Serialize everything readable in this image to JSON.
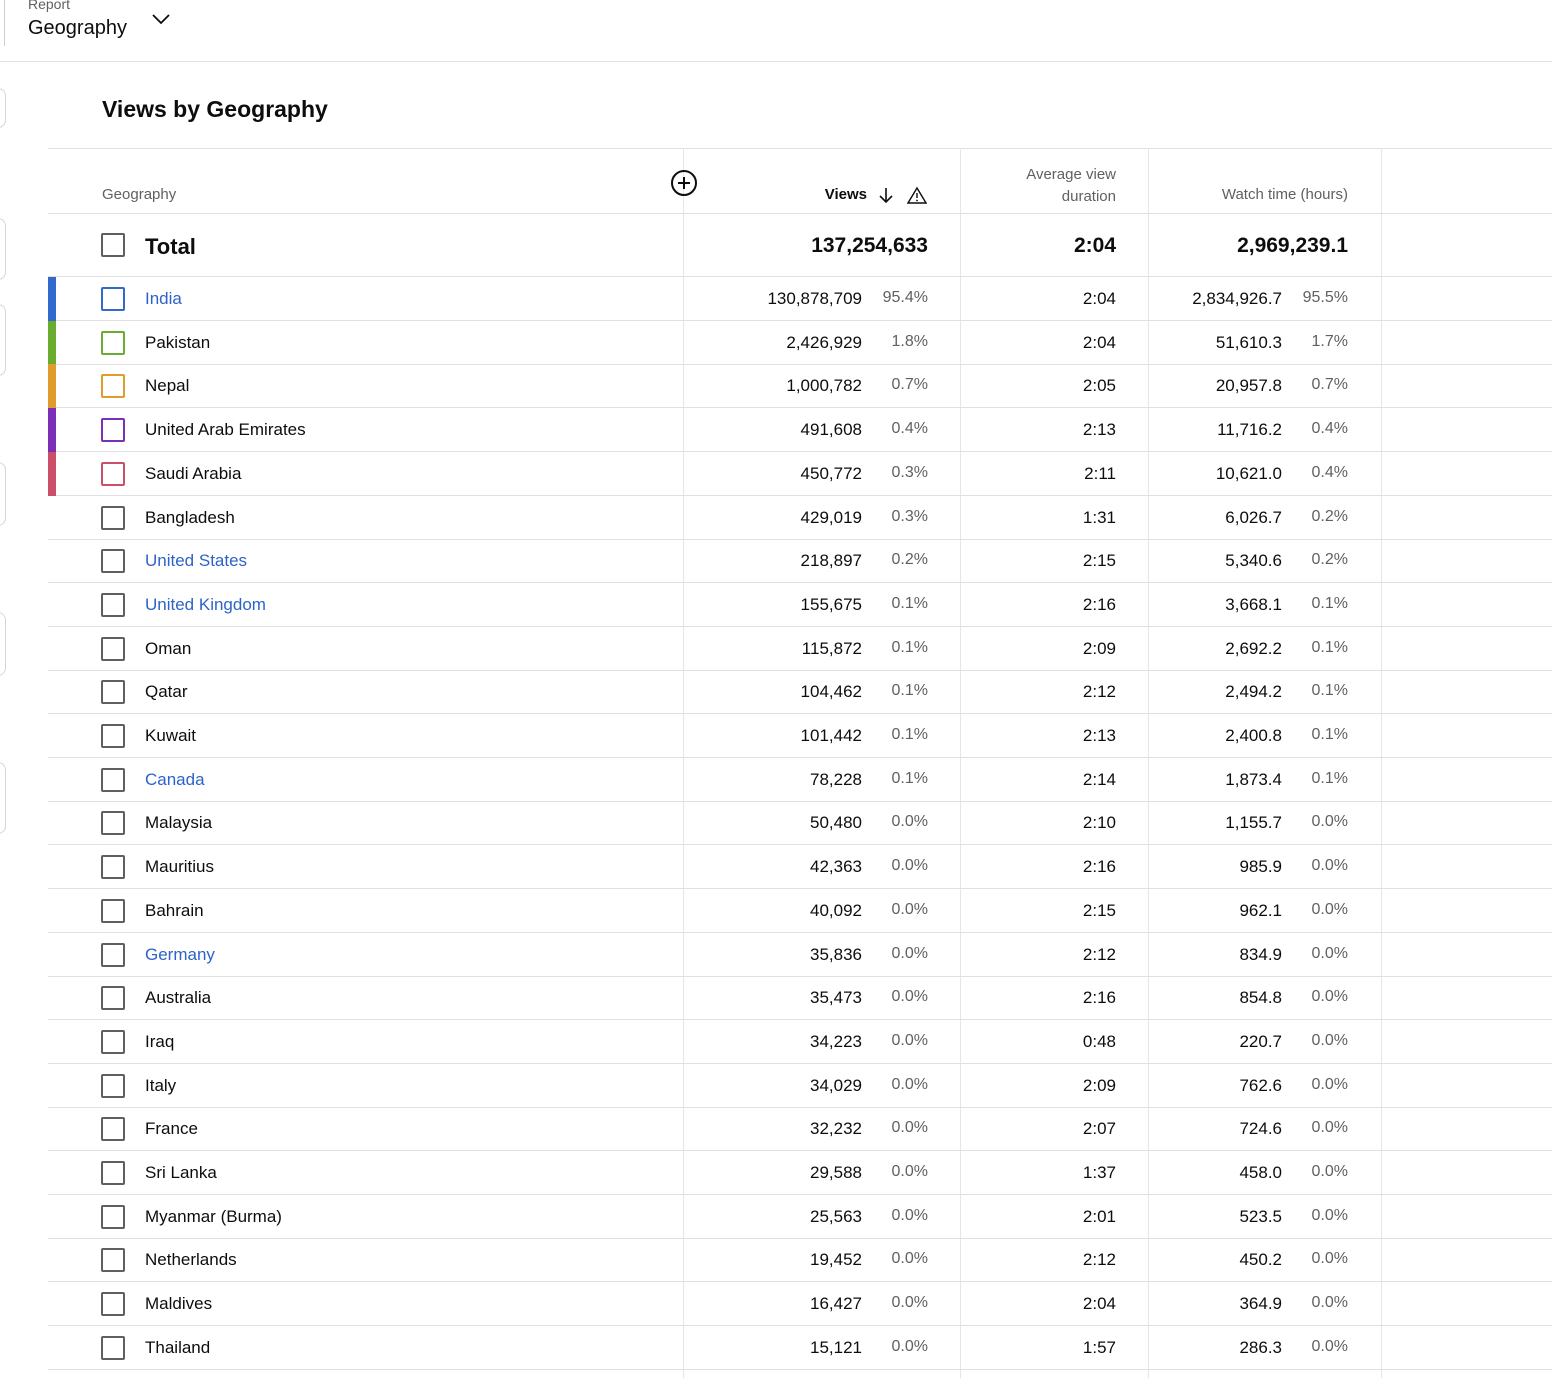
{
  "report": {
    "label": "Report",
    "value": "Geography"
  },
  "title": "Views by Geography",
  "table": {
    "headers": {
      "geography": "Geography",
      "views": "Views",
      "avg_view_duration_line1": "Average view",
      "avg_view_duration_line2": "duration",
      "watch_time": "Watch time (hours)"
    },
    "total": {
      "label": "Total",
      "views": "137,254,633",
      "avg_view_duration": "2:04",
      "watch_time": "2,969,239.1"
    },
    "rows": [
      {
        "name": "India",
        "views": "130,878,709",
        "views_pct": "95.4%",
        "avd": "2:04",
        "wt": "2,834,926.7",
        "wt_pct": "95.5%",
        "color": "#3169cc",
        "link": true
      },
      {
        "name": "Pakistan",
        "views": "2,426,929",
        "views_pct": "1.8%",
        "avd": "2:04",
        "wt": "51,610.3",
        "wt_pct": "1.7%",
        "color": "#6aac2f",
        "link": false
      },
      {
        "name": "Nepal",
        "views": "1,000,782",
        "views_pct": "0.7%",
        "avd": "2:05",
        "wt": "20,957.8",
        "wt_pct": "0.7%",
        "color": "#e09b2d",
        "link": false
      },
      {
        "name": "United Arab Emirates",
        "views": "491,608",
        "views_pct": "0.4%",
        "avd": "2:13",
        "wt": "11,716.2",
        "wt_pct": "0.4%",
        "color": "#7a2fb6",
        "link": false
      },
      {
        "name": "Saudi Arabia",
        "views": "450,772",
        "views_pct": "0.3%",
        "avd": "2:11",
        "wt": "10,621.0",
        "wt_pct": "0.4%",
        "color": "#c94f6a",
        "link": false
      },
      {
        "name": "Bangladesh",
        "views": "429,019",
        "views_pct": "0.3%",
        "avd": "1:31",
        "wt": "6,026.7",
        "wt_pct": "0.2%",
        "color": "",
        "link": false
      },
      {
        "name": "United States",
        "views": "218,897",
        "views_pct": "0.2%",
        "avd": "2:15",
        "wt": "5,340.6",
        "wt_pct": "0.2%",
        "color": "",
        "link": true
      },
      {
        "name": "United Kingdom",
        "views": "155,675",
        "views_pct": "0.1%",
        "avd": "2:16",
        "wt": "3,668.1",
        "wt_pct": "0.1%",
        "color": "",
        "link": true
      },
      {
        "name": "Oman",
        "views": "115,872",
        "views_pct": "0.1%",
        "avd": "2:09",
        "wt": "2,692.2",
        "wt_pct": "0.1%",
        "color": "",
        "link": false
      },
      {
        "name": "Qatar",
        "views": "104,462",
        "views_pct": "0.1%",
        "avd": "2:12",
        "wt": "2,494.2",
        "wt_pct": "0.1%",
        "color": "",
        "link": false
      },
      {
        "name": "Kuwait",
        "views": "101,442",
        "views_pct": "0.1%",
        "avd": "2:13",
        "wt": "2,400.8",
        "wt_pct": "0.1%",
        "color": "",
        "link": false
      },
      {
        "name": "Canada",
        "views": "78,228",
        "views_pct": "0.1%",
        "avd": "2:14",
        "wt": "1,873.4",
        "wt_pct": "0.1%",
        "color": "",
        "link": true
      },
      {
        "name": "Malaysia",
        "views": "50,480",
        "views_pct": "0.0%",
        "avd": "2:10",
        "wt": "1,155.7",
        "wt_pct": "0.0%",
        "color": "",
        "link": false
      },
      {
        "name": "Mauritius",
        "views": "42,363",
        "views_pct": "0.0%",
        "avd": "2:16",
        "wt": "985.9",
        "wt_pct": "0.0%",
        "color": "",
        "link": false
      },
      {
        "name": "Bahrain",
        "views": "40,092",
        "views_pct": "0.0%",
        "avd": "2:15",
        "wt": "962.1",
        "wt_pct": "0.0%",
        "color": "",
        "link": false
      },
      {
        "name": "Germany",
        "views": "35,836",
        "views_pct": "0.0%",
        "avd": "2:12",
        "wt": "834.9",
        "wt_pct": "0.0%",
        "color": "",
        "link": true
      },
      {
        "name": "Australia",
        "views": "35,473",
        "views_pct": "0.0%",
        "avd": "2:16",
        "wt": "854.8",
        "wt_pct": "0.0%",
        "color": "",
        "link": false
      },
      {
        "name": "Iraq",
        "views": "34,223",
        "views_pct": "0.0%",
        "avd": "0:48",
        "wt": "220.7",
        "wt_pct": "0.0%",
        "color": "",
        "link": false
      },
      {
        "name": "Italy",
        "views": "34,029",
        "views_pct": "0.0%",
        "avd": "2:09",
        "wt": "762.6",
        "wt_pct": "0.0%",
        "color": "",
        "link": false
      },
      {
        "name": "France",
        "views": "32,232",
        "views_pct": "0.0%",
        "avd": "2:07",
        "wt": "724.6",
        "wt_pct": "0.0%",
        "color": "",
        "link": false
      },
      {
        "name": "Sri Lanka",
        "views": "29,588",
        "views_pct": "0.0%",
        "avd": "1:37",
        "wt": "458.0",
        "wt_pct": "0.0%",
        "color": "",
        "link": false
      },
      {
        "name": "Myanmar (Burma)",
        "views": "25,563",
        "views_pct": "0.0%",
        "avd": "2:01",
        "wt": "523.5",
        "wt_pct": "0.0%",
        "color": "",
        "link": false
      },
      {
        "name": "Netherlands",
        "views": "19,452",
        "views_pct": "0.0%",
        "avd": "2:12",
        "wt": "450.2",
        "wt_pct": "0.0%",
        "color": "",
        "link": false
      },
      {
        "name": "Maldives",
        "views": "16,427",
        "views_pct": "0.0%",
        "avd": "2:04",
        "wt": "364.9",
        "wt_pct": "0.0%",
        "color": "",
        "link": false
      },
      {
        "name": "Thailand",
        "views": "15,121",
        "views_pct": "0.0%",
        "avd": "1:57",
        "wt": "286.3",
        "wt_pct": "0.0%",
        "color": "",
        "link": false
      }
    ]
  }
}
